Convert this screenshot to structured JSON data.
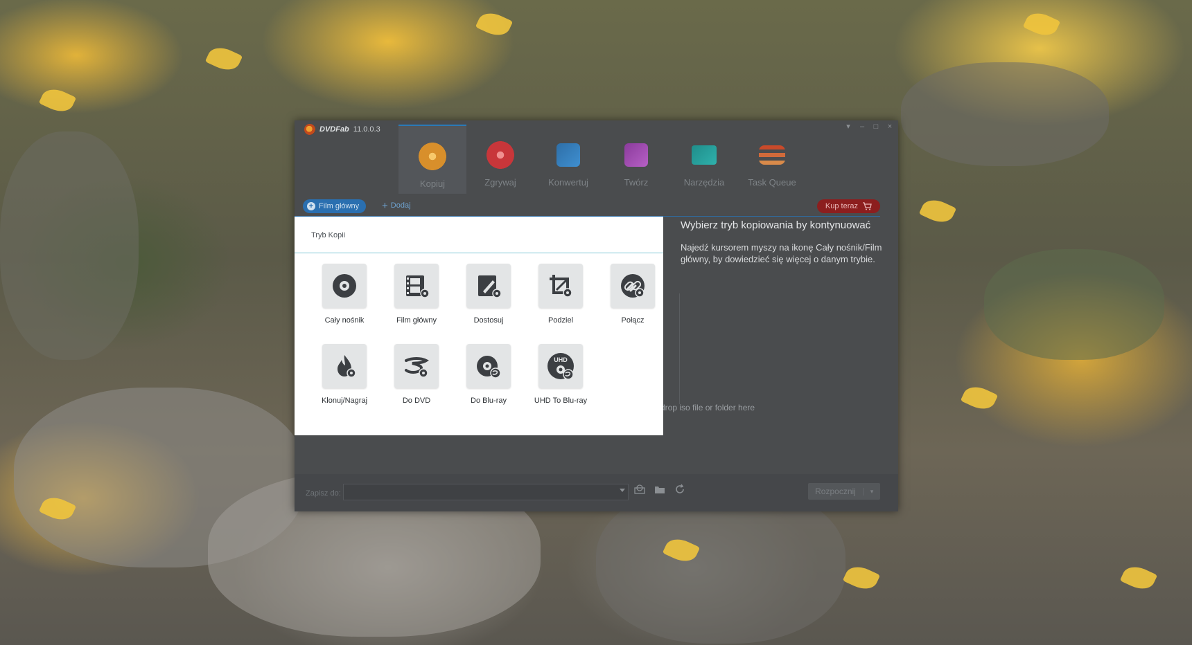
{
  "app": {
    "name": "DVDFab",
    "version": "11.0.0.3"
  },
  "window_controls": [
    "▾",
    "–",
    "□",
    "×"
  ],
  "toolbar": {
    "items": [
      {
        "label": "Kopiuj",
        "icon": "copy-disc-icon",
        "active": true
      },
      {
        "label": "Zgrywaj",
        "icon": "rip-disc-icon",
        "active": false
      },
      {
        "label": "Konwertuj",
        "icon": "convert-film-icon",
        "active": false
      },
      {
        "label": "Twórz",
        "icon": "create-film-icon",
        "active": false
      },
      {
        "label": "Narzędzia",
        "icon": "tools-folder-icon",
        "active": false
      },
      {
        "label": "Task Queue",
        "icon": "task-queue-icon",
        "active": false
      }
    ]
  },
  "subbar": {
    "mode_pill": "Film główny",
    "add_label": "Dodaj",
    "buy_label": "Kup teraz"
  },
  "copy_mode_popup": {
    "title": "Tryb Kopii",
    "modes": [
      {
        "label": "Cały nośnik",
        "icon": "full-disc-icon"
      },
      {
        "label": "Film główny",
        "icon": "main-movie-icon"
      },
      {
        "label": "Dostosuj",
        "icon": "customize-icon"
      },
      {
        "label": "Podziel",
        "icon": "split-icon"
      },
      {
        "label": "Połącz",
        "icon": "merge-icon"
      },
      {
        "label": "Klonuj/Nagraj",
        "icon": "clone-burn-icon"
      },
      {
        "label": "Do DVD",
        "icon": "to-dvd-icon"
      },
      {
        "label": "Do Blu-ray",
        "icon": "to-bluray-icon"
      },
      {
        "label": "UHD To Blu-ray",
        "icon": "uhd-to-bluray-icon"
      }
    ]
  },
  "info_panel": {
    "heading": "Wybierz tryb kopiowania by kontynuować",
    "text": "Najedź kursorem myszy na ikonę Cały nośnik/Film główny, by dowiedzieć się więcej o danym trybie.",
    "drop_hint": "drop iso file or folder here"
  },
  "bottom_bar": {
    "save_label": "Zapisz do:",
    "save_value": "",
    "start_label": "Rozpocznij"
  },
  "colors": {
    "accent_blue": "#2a6fb0",
    "buy_red": "#8c1e1e",
    "window_bg": "#4a4c4e"
  }
}
